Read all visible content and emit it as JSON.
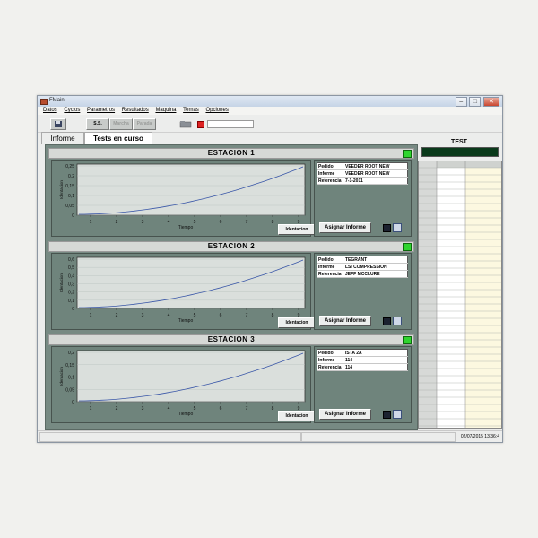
{
  "window": {
    "title": "FMain",
    "controls": [
      "–",
      "□",
      "✕"
    ]
  },
  "menu": [
    "Datos",
    "Cyclos",
    "Parametros",
    "Resultados",
    "Maquina",
    "Temas",
    "Opciones"
  ],
  "toolbar": {
    "btn1": "S.S.",
    "btn2": "Marcha",
    "btn3": "Parada"
  },
  "tabs": [
    {
      "label": "Informe"
    },
    {
      "label": "Tests en curso"
    }
  ],
  "stations": [
    {
      "title": "ESTACION  1",
      "y_ticks": [
        "0,25",
        "0,2",
        "0,15",
        "0,1",
        "0,05",
        "0"
      ],
      "y_max": 0.25,
      "y_label": "Identacion",
      "x_ticks": [
        "1",
        "2",
        "3",
        "4",
        "5",
        "6",
        "7",
        "8",
        "9"
      ],
      "x_label": "Tiempo",
      "ident_button": "Identacion",
      "info": {
        "pedido_label": "Pedido",
        "pedido": "VEEDER ROOT NEW",
        "informe_label": "Informe",
        "informe": "VEEDER ROOT NEW",
        "referencia_label": "Referencia",
        "referencia": "7-1-2011"
      },
      "assign_button": "Asignar Informe"
    },
    {
      "title": "ESTACION  2",
      "y_ticks": [
        "0,6",
        "0,5",
        "0,4",
        "0,3",
        "0,2",
        "0,1",
        "0"
      ],
      "y_max": 0.6,
      "y_label": "Identacion",
      "x_ticks": [
        "1",
        "2",
        "3",
        "4",
        "5",
        "6",
        "7",
        "8",
        "9"
      ],
      "x_label": "Tiempo",
      "ident_button": "Identacion",
      "info": {
        "pedido_label": "Pedido",
        "pedido": "TEGRANT",
        "informe_label": "Informe",
        "informe": "LSI COMPRESSION",
        "referencia_label": "Referencia",
        "referencia": "JEFF MCCLURE"
      },
      "assign_button": "Asignar Informe"
    },
    {
      "title": "ESTACION  3",
      "y_ticks": [
        "0,2",
        "0,15",
        "0,1",
        "0,05",
        "0"
      ],
      "y_max": 0.22,
      "y_label": "Identacion",
      "x_ticks": [
        "1",
        "2",
        "3",
        "4",
        "5",
        "6",
        "7",
        "8",
        "9"
      ],
      "x_label": "Tiempo",
      "ident_button": "Identacion",
      "info": {
        "pedido_label": "Pedido",
        "pedido": "ISTA 2A",
        "informe_label": "Informe",
        "informe": "114",
        "referencia_label": "Referencia",
        "referencia": "114"
      },
      "assign_button": "Asignar Informe"
    }
  ],
  "right_panel": {
    "label": "TEST"
  },
  "status": {
    "datetime": "02/07/2015 13:36:4"
  },
  "colors": {
    "chart_bg": "#6f847c",
    "plot_bg": "#dadfdc",
    "led": "#2fd52f",
    "test_bar": "#0a3a1b"
  },
  "icons": [
    "save-icon",
    "search-icon",
    "folder-icon",
    "stop-icon"
  ]
}
